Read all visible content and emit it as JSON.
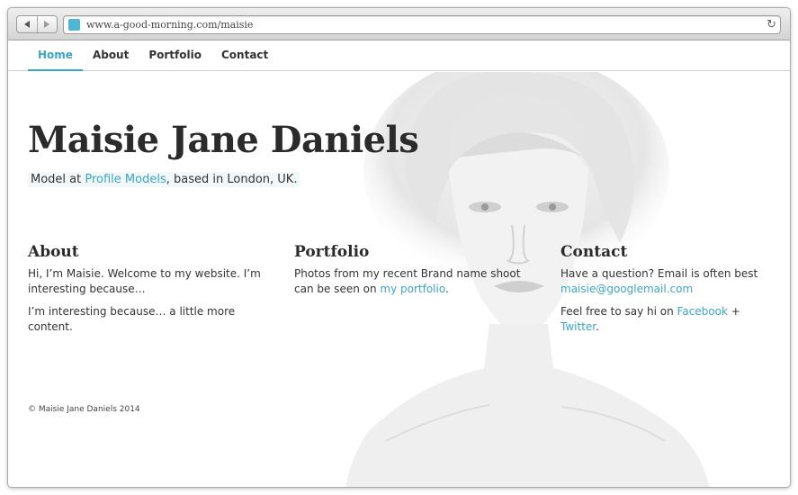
{
  "browser": {
    "url": "www.a-good-morning.com/maisie",
    "icons": [
      "back-arrow-icon",
      "forward-arrow-icon",
      "favicon-icon",
      "reload-icon"
    ]
  },
  "nav": {
    "items": [
      {
        "label": "Home",
        "active": true
      },
      {
        "label": "Portfolio",
        "active": false
      },
      {
        "label": "About",
        "active": false
      },
      {
        "label": "Contact",
        "active": false
      }
    ]
  },
  "hero": {
    "name": "Maisie Jane Daniels",
    "tagline_prefix": "Model at ",
    "tagline_link": "Profile Models",
    "tagline_suffix": ", based in London, UK."
  },
  "about": {
    "heading": "About",
    "p1": "Hi, I’m Maisie. Welcome to my website. I’m interesting because…",
    "p2": "I’m interesting because… a little more content."
  },
  "portfolio": {
    "heading": "Portfolio",
    "text_prefix": "Photos from my recent Brand name shoot can be seen on ",
    "link": "my portfolio",
    "text_suffix": "."
  },
  "contact": {
    "heading": "Contact",
    "line1": "Have a question? Email is often best",
    "email": "maisie@googlemail.com",
    "line2_prefix": "Feel free to say hi on ",
    "facebook": "Facebook",
    "plus": " + ",
    "twitter": "Twitter",
    "line2_suffix": "."
  },
  "footer": {
    "text": "© Maisie Jane Daniels 2014"
  },
  "colors": {
    "accent": "#3aa6c6",
    "text": "#333333"
  }
}
